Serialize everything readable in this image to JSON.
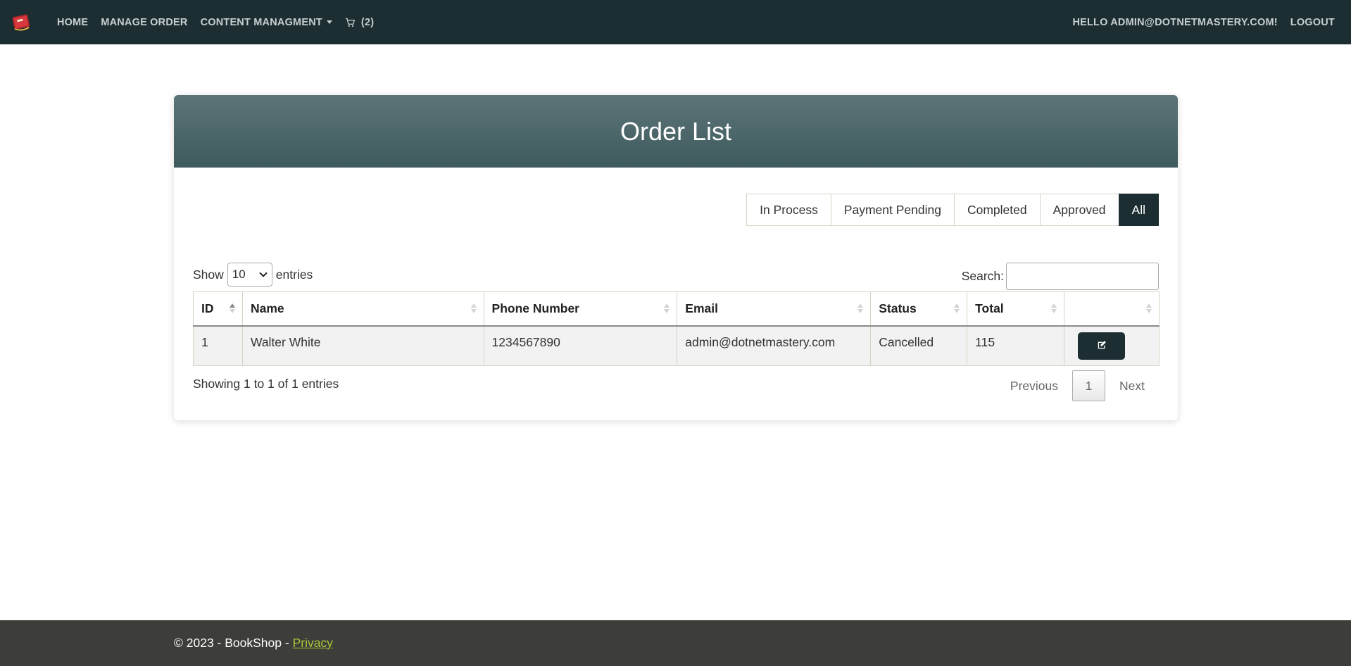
{
  "navbar": {
    "brand_icon": "book-logo-icon",
    "home": "HOME",
    "manage_order": "MANAGE ORDER",
    "content_management": "CONTENT MANAGMENT",
    "cart_count": "(2)",
    "greeting": "HELLO ADMIN@DOTNETMASTERY.COM!",
    "logout": "LOGOUT"
  },
  "card": {
    "title": "Order List"
  },
  "filters": {
    "in_process": "In Process",
    "payment_pending": "Payment Pending",
    "completed": "Completed",
    "approved": "Approved",
    "all": "All",
    "active": "All"
  },
  "table_controls": {
    "show_label": "Show",
    "page_length": "10",
    "entries_label": "entries",
    "search_label": "Search:",
    "search_value": ""
  },
  "table": {
    "columns": [
      "ID",
      "Name",
      "Phone Number",
      "Email",
      "Status",
      "Total",
      ""
    ],
    "rows": [
      {
        "id": "1",
        "name": "Walter White",
        "phone": "1234567890",
        "email": "admin@dotnetmastery.com",
        "status": "Cancelled",
        "total": "115"
      }
    ]
  },
  "pagination": {
    "info": "Showing 1 to 1 of 1 entries",
    "previous": "Previous",
    "current_page": "1",
    "next": "Next"
  },
  "footer": {
    "copyright": "© 2023 - BookShop - ",
    "privacy": "Privacy"
  },
  "colors": {
    "navbar_bg": "#1c2e31",
    "header_gradient_top": "#5b7478",
    "header_gradient_bottom": "#3f5a5d",
    "footer_bg": "#3d3d39",
    "footer_link": "#a8c93a"
  }
}
